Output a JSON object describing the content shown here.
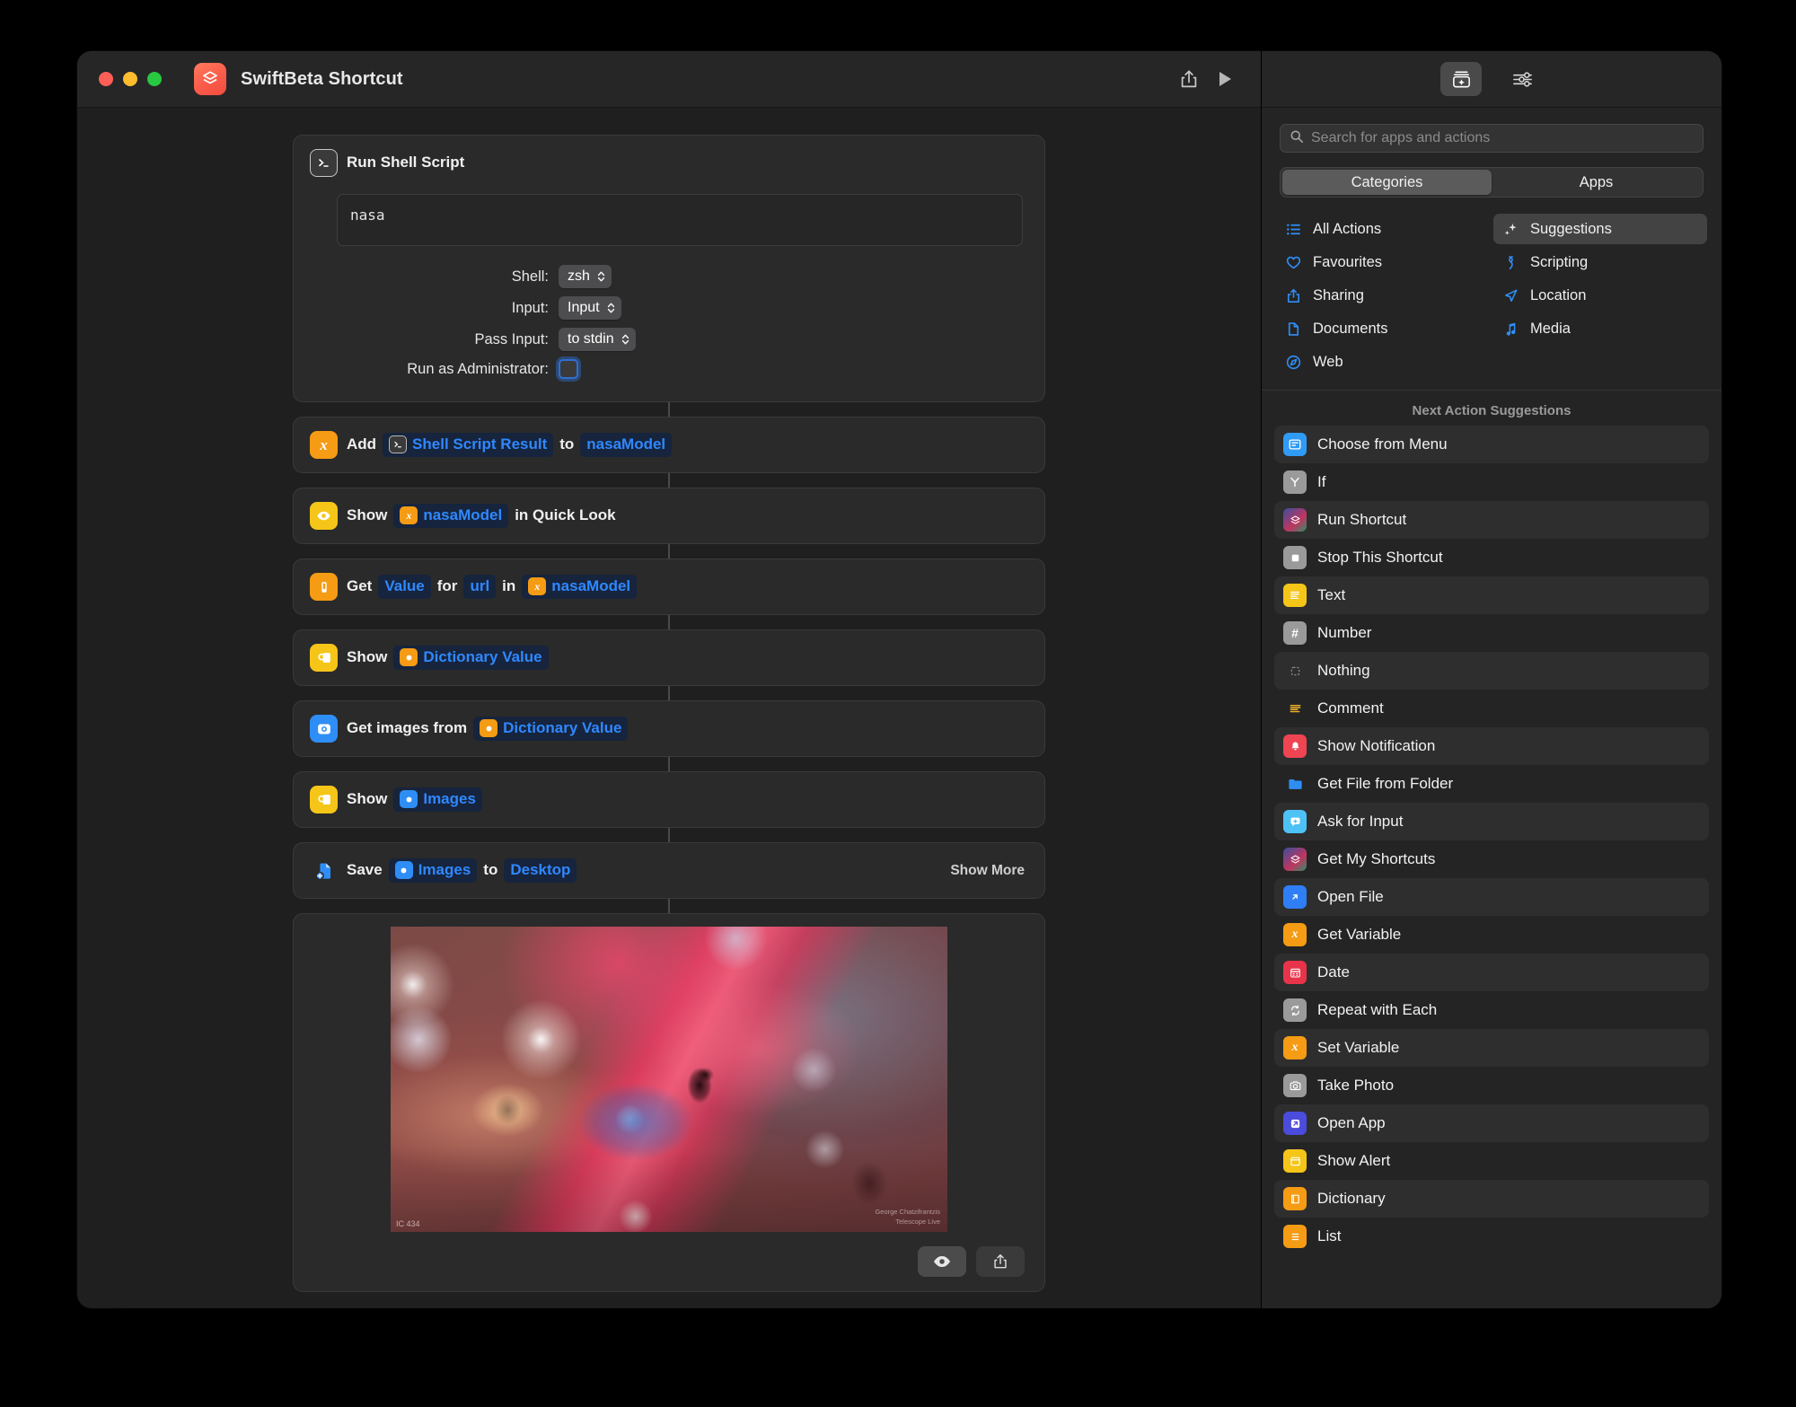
{
  "window": {
    "title": "SwiftBeta Shortcut",
    "app_icon": "shortcuts-icon",
    "traffic_lights": [
      "close",
      "minimize",
      "zoom"
    ],
    "toolbar": {
      "share_label": "share-icon",
      "run_label": "play-icon"
    }
  },
  "library": {
    "toolbar": {
      "action_library_label": "action-library-icon",
      "details_label": "sliders-icon"
    },
    "search": {
      "placeholder": "Search for apps and actions",
      "value": ""
    },
    "tabs": [
      {
        "label": "Categories",
        "active": true
      },
      {
        "label": "Apps",
        "active": false
      }
    ],
    "categories": [
      {
        "label": "All Actions",
        "icon": "list-icon",
        "active": false
      },
      {
        "label": "Suggestions",
        "icon": "sparkles-icon",
        "active": true
      },
      {
        "label": "Favourites",
        "icon": "heart-icon",
        "active": false
      },
      {
        "label": "Scripting",
        "icon": "scripting-icon",
        "active": false
      },
      {
        "label": "Sharing",
        "icon": "share-icon",
        "active": false
      },
      {
        "label": "Location",
        "icon": "location-arrow-icon",
        "active": false
      },
      {
        "label": "Documents",
        "icon": "document-icon",
        "active": false
      },
      {
        "label": "Media",
        "icon": "music-note-icon",
        "active": false
      },
      {
        "label": "Web",
        "icon": "compass-icon",
        "active": false
      }
    ],
    "suggestions_title": "Next Action Suggestions",
    "suggestions": [
      {
        "label": "Choose from Menu",
        "icon": "menu-icon",
        "color": "#2f9bf5"
      },
      {
        "label": "If",
        "icon": "branch-icon",
        "color": "#9a9a9a"
      },
      {
        "label": "Run Shortcut",
        "icon": "shortcuts-icon",
        "color": "#2a3a6e"
      },
      {
        "label": "Stop This Shortcut",
        "icon": "stop-icon",
        "color": "#9a9a9a"
      },
      {
        "label": "Text",
        "icon": "text-icon",
        "color": "#f5c518"
      },
      {
        "label": "Number",
        "icon": "number-icon",
        "color": "#9a9a9a"
      },
      {
        "label": "Nothing",
        "icon": "nothing-icon",
        "color": "transparent"
      },
      {
        "label": "Comment",
        "icon": "comment-icon",
        "color": "transparent"
      },
      {
        "label": "Show Notification",
        "icon": "bell-icon",
        "color": "#ef4452"
      },
      {
        "label": "Get File from Folder",
        "icon": "folder-icon",
        "color": "transparent"
      },
      {
        "label": "Ask for Input",
        "icon": "ask-input-icon",
        "color": "#4ec2f5"
      },
      {
        "label": "Get My Shortcuts",
        "icon": "shortcuts-icon",
        "color": "#2a3a6e"
      },
      {
        "label": "Open File",
        "icon": "open-file-icon",
        "color": "#2f7ef5"
      },
      {
        "label": "Get Variable",
        "icon": "variable-icon",
        "color": "#f59b14"
      },
      {
        "label": "Date",
        "icon": "calendar-icon",
        "color": "#e8344a"
      },
      {
        "label": "Repeat with Each",
        "icon": "repeat-icon",
        "color": "#9a9a9a"
      },
      {
        "label": "Set Variable",
        "icon": "variable-icon",
        "color": "#f59b14"
      },
      {
        "label": "Take Photo",
        "icon": "camera-icon",
        "color": "#9a9a9a"
      },
      {
        "label": "Open App",
        "icon": "open-app-icon",
        "color": "#4b4bdc"
      },
      {
        "label": "Show Alert",
        "icon": "alert-icon",
        "color": "#f5c518"
      },
      {
        "label": "Dictionary",
        "icon": "dictionary-icon",
        "color": "#f59b14"
      },
      {
        "label": "List",
        "icon": "list-action-icon",
        "color": "#f59b14"
      }
    ]
  },
  "flow": {
    "shell_action": {
      "title": "Run Shell Script",
      "icon": "terminal-icon",
      "script": "nasa",
      "params": [
        {
          "label": "Shell:",
          "value": "zsh",
          "type": "popup"
        },
        {
          "label": "Input:",
          "value": "Input",
          "type": "popup"
        },
        {
          "label": "Pass Input:",
          "value": "to stdin",
          "type": "popup"
        },
        {
          "label": "Run as Administrator:",
          "value": "",
          "type": "checkbox",
          "checked": false
        }
      ]
    },
    "actions": [
      {
        "icon": "variable-icon",
        "icon_color": "#f59b14",
        "parts": [
          {
            "kind": "text",
            "text": "Add"
          },
          {
            "kind": "token",
            "text": "Shell Script Result",
            "icon": "terminal-icon",
            "icon_color": "#3a3a3a"
          },
          {
            "kind": "text",
            "text": "to"
          },
          {
            "kind": "token",
            "text": "nasaModel",
            "icon": ""
          }
        ]
      },
      {
        "icon": "eye-icon",
        "icon_color": "#f5c518",
        "parts": [
          {
            "kind": "text",
            "text": "Show"
          },
          {
            "kind": "token",
            "text": "nasaModel",
            "icon": "variable-icon",
            "icon_color": "#f59b14"
          },
          {
            "kind": "text",
            "text": "in Quick Look"
          }
        ]
      },
      {
        "icon": "dictionary-value-icon",
        "icon_color": "#f59b14",
        "parts": [
          {
            "kind": "text",
            "text": "Get"
          },
          {
            "kind": "token",
            "text": "Value",
            "icon": ""
          },
          {
            "kind": "text",
            "text": "for"
          },
          {
            "kind": "token",
            "text": "url",
            "icon": ""
          },
          {
            "kind": "text",
            "text": "in"
          },
          {
            "kind": "token",
            "text": "nasaModel",
            "icon": "variable-icon",
            "icon_color": "#f59b14"
          }
        ]
      },
      {
        "icon": "quicklook-icon",
        "icon_color": "#f5c518",
        "parts": [
          {
            "kind": "text",
            "text": "Show"
          },
          {
            "kind": "token",
            "text": "Dictionary Value",
            "icon": "dict-dot-icon",
            "icon_color": "#f59b14"
          }
        ]
      },
      {
        "icon": "get-images-icon",
        "icon_color": "#2f8ef5",
        "parts": [
          {
            "kind": "text",
            "text": "Get images from"
          },
          {
            "kind": "token",
            "text": "Dictionary Value",
            "icon": "dict-dot-icon",
            "icon_color": "#f59b14"
          }
        ]
      },
      {
        "icon": "quicklook-icon",
        "icon_color": "#f5c518",
        "parts": [
          {
            "kind": "text",
            "text": "Show"
          },
          {
            "kind": "token",
            "text": "Images",
            "icon": "images-dot-icon",
            "icon_color": "#2f8ef5"
          }
        ]
      },
      {
        "icon": "save-file-icon",
        "icon_color": "transparent",
        "show_more": "Show More",
        "parts": [
          {
            "kind": "text",
            "text": "Save"
          },
          {
            "kind": "token",
            "text": "Images",
            "icon": "images-dot-icon",
            "icon_color": "#2f8ef5"
          },
          {
            "kind": "text",
            "text": "to"
          },
          {
            "kind": "token",
            "text": "Desktop",
            "icon": ""
          }
        ]
      }
    ],
    "preview": {
      "image_caption": "IC 434",
      "image_credit": "George Chatzifrantzis",
      "image_credit_2": "Telescope Live",
      "quicklook_label": "eye-icon",
      "share_label": "share-icon"
    }
  }
}
